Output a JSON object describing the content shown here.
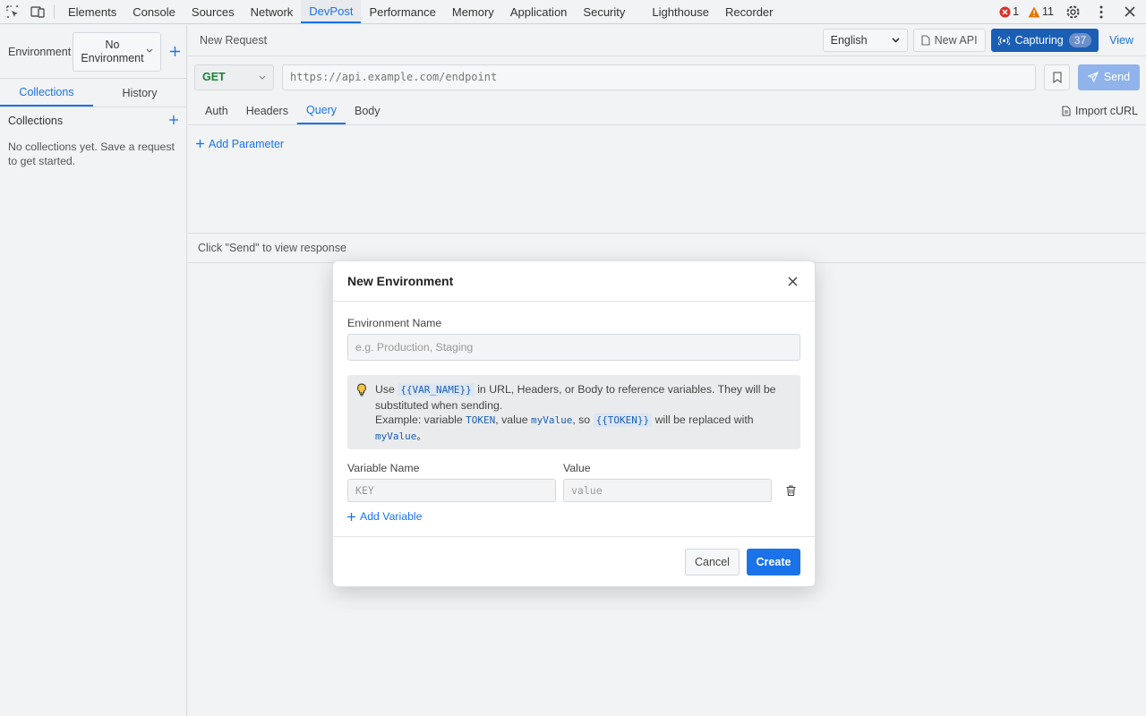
{
  "devtools": {
    "tabs": [
      "Elements",
      "Console",
      "Sources",
      "Network",
      "DevPost",
      "Performance",
      "Memory",
      "Application",
      "Security",
      "Lighthouse",
      "Recorder"
    ],
    "active_tab": "DevPost",
    "error_count": "1",
    "warning_count": "11",
    "icons": {
      "inspect": "inspect-element-icon",
      "device": "device-toolbar-icon",
      "settings": "gear-icon",
      "more": "more-vertical-icon",
      "close": "close-icon"
    }
  },
  "sidebar": {
    "env_label": "Environment",
    "env_value": "No Environment",
    "tabs": [
      "Collections",
      "History"
    ],
    "collections_title": "Collections",
    "empty_text": "No collections yet. Save a request to get started."
  },
  "main": {
    "title": "New Request",
    "language": "English",
    "new_api_label": "New API",
    "capture_label": "Capturing",
    "capture_count": "37",
    "view_label": "View",
    "method": "GET",
    "url_placeholder": "https://api.example.com/endpoint",
    "send_label": "Send",
    "tabs": [
      "Auth",
      "Headers",
      "Query",
      "Body"
    ],
    "active_tab": "Query",
    "import_label": "Import cURL",
    "add_param_label": "Add Parameter",
    "response_hint": "Click \"Send\" to view response"
  },
  "modal": {
    "title": "New Environment",
    "name_label": "Environment Name",
    "name_placeholder": "e.g. Production, Staging",
    "hint": {
      "use": "Use",
      "var_syntax": "{{VAR_NAME}}",
      "line1_rest": "in URL, Headers, or Body to reference variables. They will be substituted when sending.",
      "example_prefix": "Example: variable",
      "example_var": "TOKEN",
      "example_mid": ", value",
      "example_value": "myValue",
      "example_so": ", so",
      "example_token": "{{TOKEN}}",
      "example_replaced": "will be replaced with",
      "example_end": "myValue。"
    },
    "var_name_label": "Variable Name",
    "value_label": "Value",
    "key_placeholder": "KEY",
    "value_placeholder": "value",
    "add_var_label": "Add Variable",
    "cancel_label": "Cancel",
    "create_label": "Create"
  },
  "colors": {
    "accent": "#1a73e8",
    "capture_bg": "#1a5fb4",
    "error": "#d93025",
    "warning": "#e37400",
    "method_get": "#188038"
  }
}
